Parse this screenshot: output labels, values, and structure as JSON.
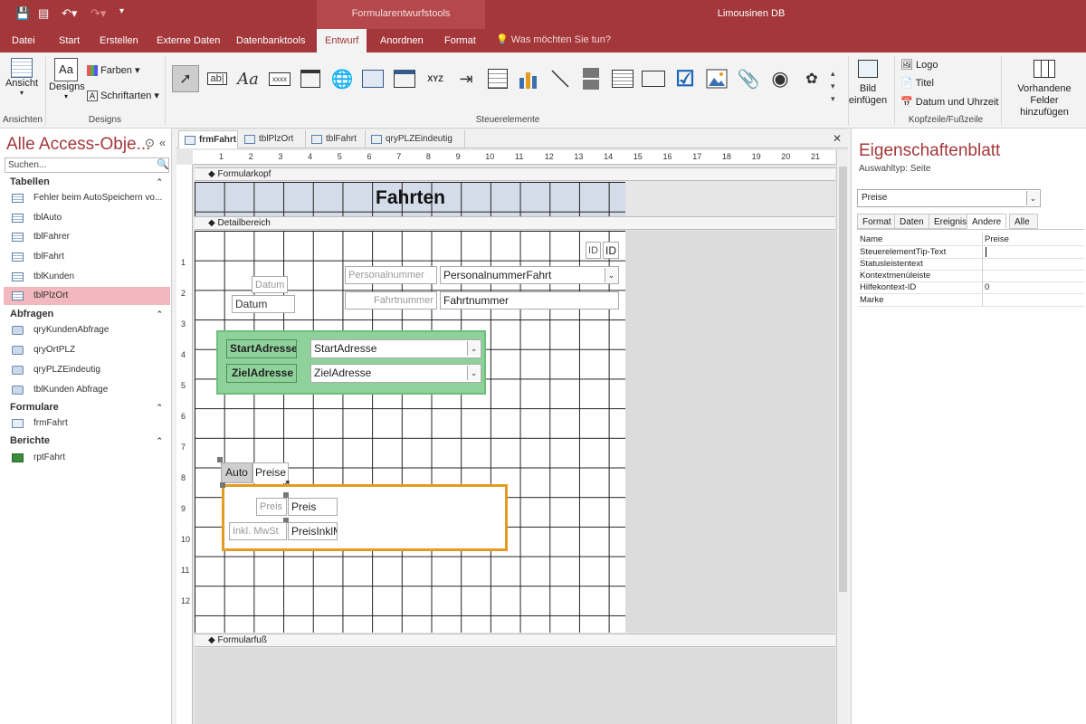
{
  "title_bar": {
    "context_title": "Formularentwurfstools",
    "app_title": "Limousinen DB"
  },
  "tabs": [
    "Datei",
    "Start",
    "Erstellen",
    "Externe Daten",
    "Datenbanktools",
    "Entwurf",
    "Anordnen",
    "Format"
  ],
  "tell_me": "Was möchten Sie tun?",
  "ribbon": {
    "ansicht": "Ansicht",
    "ansichten_label": "Ansichten",
    "designs": "Designs",
    "farben": "Farben",
    "schriftarten": "Schriftarten",
    "designs_label": "Designs",
    "controls_label": "Steuerelemente",
    "bild_einfuegen": "Bild einfügen",
    "logo": "Logo",
    "titel": "Titel",
    "datum_uhrzeit": "Datum und Uhrzeit",
    "kopfzeile_label": "Kopfzeile/Fußzeile",
    "vorhandene_felder": "Vorhandene Felder hinzufügen",
    "textbox_glyph": "ab|",
    "label_glyph": "Aa",
    "button_glyph": "xxxx",
    "optiongroup_glyph": "XYZ"
  },
  "nav": {
    "title": "Alle Access-Obje...",
    "search_placeholder": "Suchen...",
    "sections": [
      {
        "label": "Tabellen",
        "items": [
          "Fehler beim AutoSpeichern vo...",
          "tblAuto",
          "tblFahrer",
          "tblFahrt",
          "tblKunden",
          "tblPlzOrt"
        ]
      },
      {
        "label": "Abfragen",
        "items": [
          "qryKundenAbfrage",
          "qryOrtPLZ",
          "qryPLZEindeutig",
          "tblKunden Abfrage"
        ]
      },
      {
        "label": "Formulare",
        "items": [
          "frmFahrt"
        ]
      },
      {
        "label": "Berichte",
        "items": [
          "rptFahrt"
        ]
      }
    ]
  },
  "doc_tabs": [
    "frmFahrt",
    "tblPlzOrt",
    "tblFahrt",
    "qryPLZEindeutig"
  ],
  "form": {
    "header_section": "Formularkopf",
    "detail_section": "Detailbereich",
    "footer_section": "Formularfuß",
    "title": "Fahrten",
    "id_label": "ID",
    "id_field": "ID",
    "personalnummer_label": "Personalnummer",
    "personalnummer_field": "PersonalnummerFahrt",
    "fahrtnummer_label": "Fahrtnummer",
    "fahrtnummer_field": "Fahrtnummer",
    "datum_label": "Datum",
    "datum_field": "Datum",
    "startadresse_label": "StartAdresse",
    "startadresse_field": "StartAdresse",
    "zieladresse_label": "ZielAdresse",
    "zieladresse_field": "ZielAdresse",
    "tab_auto": "Auto",
    "tab_preise": "Preise",
    "preis_label": "Preis",
    "preis_field": "Preis",
    "inkl_label": "Inkl. MwSt",
    "inkl_field": "PreisInklM"
  },
  "ruler_ticks": [
    "1",
    "2",
    "3",
    "4",
    "5",
    "6",
    "7",
    "8",
    "9",
    "10",
    "11",
    "12",
    "13",
    "14",
    "15",
    "16",
    "17",
    "18",
    "19",
    "20",
    "21"
  ],
  "vruler_ticks": [
    "1",
    "2",
    "3",
    "4",
    "5",
    "6",
    "7",
    "8",
    "9",
    "10",
    "11",
    "12"
  ],
  "props": {
    "title": "Eigenschaftenblatt",
    "subtitle": "Auswahltyp:  Seite",
    "selected": "Preise",
    "tabs": [
      "Format",
      "Daten",
      "Ereignis",
      "Andere",
      "Alle"
    ],
    "active_tab": "Andere",
    "rows": [
      {
        "name": "Name",
        "value": "Preise"
      },
      {
        "name": "SteuerelementTip-Text",
        "value": ""
      },
      {
        "name": "Statusleistentext",
        "value": ""
      },
      {
        "name": "Kontextmenüleiste",
        "value": ""
      },
      {
        "name": "Hilfekontext-ID",
        "value": "0"
      },
      {
        "name": "Marke",
        "value": ""
      }
    ]
  },
  "colors": {
    "accent": "#a4373a",
    "nav_selected": "#f2b8bd",
    "address_group_bg": "#8fd19b",
    "tab_control_border": "#e39b22",
    "header_band": "#d4dbe9"
  }
}
